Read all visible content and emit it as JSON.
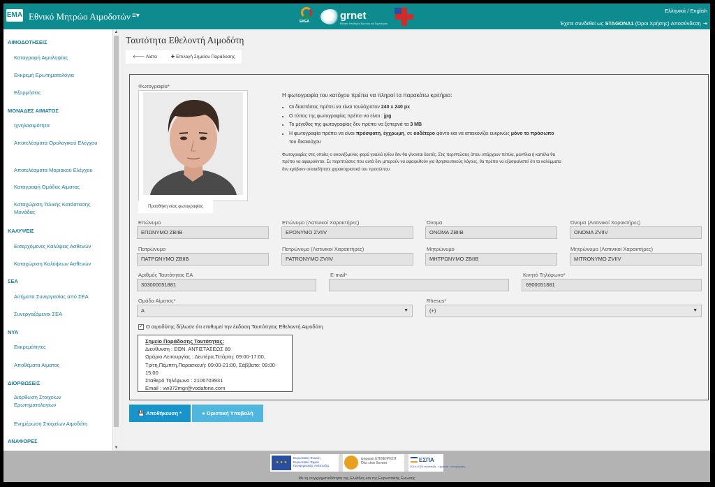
{
  "header": {
    "logo_text": "EMA",
    "app_title": "Εθνικό Μητρώο Αιμοδοτών",
    "menu_toggle": "≡▾",
    "edha_label": "ΕΚΕΑ",
    "grnet_label": "grnet",
    "grnet_tagline": "Εθνικές Υποδομές Έρευνας και Τεχνολογίας",
    "language": "Ελληνικά / English",
    "login_prefix": "Έχετε συνδεθεί ως ",
    "username": "STAGONA1",
    "terms": " (Όροι Χρήσης)",
    "logout": " Αποσύνδεση",
    "logout_icon": "⇥"
  },
  "sidebar": {
    "sections": [
      {
        "title": "ΑΙΜΟΔΟΤΗΣΕΙΣ",
        "items": [
          "Καταγραφή Αιμοληψίας",
          "Εκκρεμή Ερωτηματολόγια",
          "Εξορμήσεις"
        ]
      },
      {
        "title": "ΜΟΝΑΔΕΣ ΑΙΜΑΤΟΣ",
        "items": [
          "Ιχνηλασιμότητα",
          "Αποτελέσματα Ορολογικού Ελέγχου",
          "Αποτελέσματα Μοριακού Ελέγχου",
          "Καταγραφή Ομάδας Αίματος",
          "Καταχώριση Τελικής Κατάστασης Μονάδας"
        ]
      },
      {
        "title": "ΚΑΛΥΨΕΙΣ",
        "items": [
          "Εισερχόμενες Καλύψεις Ασθενών",
          "Καταχώριση Καλύψεων Ασθενών"
        ]
      },
      {
        "title": "ΣΕΑ",
        "items": [
          "Αιτήματα Συνεργασίας από ΣΕΑ",
          "Συνεργαζόμενοι ΣΕΑ"
        ]
      },
      {
        "title": "ΝΥΑ",
        "items": [
          "Εκκρεμότητες",
          "Αποθέματα Αίματος"
        ]
      },
      {
        "title": "ΔΙΟΡΘΩΣΕΙΣ",
        "items": [
          "Διόρθωση Στοιχείων Ερωτηματολογίων",
          "Ενημέρωση Στοιχείων Αιμοδότη"
        ]
      },
      {
        "title": "ΑΝΑΦΟΡΕΣ",
        "items": []
      }
    ]
  },
  "main": {
    "page_title": "Ταυτότητα Εθελοντή Αιμοδότη",
    "tabs": [
      "🡐 Λίστα",
      "✚ Επιλογή Σημείου Παράδοσης"
    ],
    "photo_label": "Φωτογραφία*",
    "add_photo": "Προσθήκη νέας φωτογραφίας",
    "criteria_title": "Η φωτογραφία του κατόχου πρέπει να πληροί τα παρακάτω κριτήρια:",
    "criteria": [
      {
        "pre": "Οι διαστάσεις πρέπει να είναι τουλάχιστον ",
        "bold": "240 x 240 px",
        "post": ""
      },
      {
        "pre": "Ο τύπος της φωτογραφίας πρέπει να είναι : ",
        "bold": "jpg",
        "post": ""
      },
      {
        "pre": "Το μέγεθος της φωτογραφίας δεν πρέπει να ξεπερνά τα ",
        "bold": "3 MB",
        "post": ""
      }
    ],
    "criteria_last": {
      "a": "Η φωτογραφία πρέπει να είναι ",
      "b": "πρόσφατη",
      "c": ", ",
      "d": "έγχρωμη",
      "e": ", σε ",
      "f": "ουδέτερο",
      "g": " φόντο και να απεικονίζει ευκρινώς ",
      "h": "μόνο το πρόσωπο",
      "i": " του δικαιούχου"
    },
    "criteria_note": "Φωτογραφίες στις οποίες ο εικονιζόμενος φορά γυαλιά ηλίου δεν θα γίνονται δεκτές. Στις περιπτώσεις όπου υπάρχουν πέπλα, μαντίλια ή καπέλα θα πρέπει να αφαιρούνται. Σε περιπτώσεις που αυτά δεν μπορούν να αφαιρεθούν για θρησκευτικούς λόγους, θα πρέπει να εξασφαλιστεί ότι τα καλύμματα δεν κρύβουν οποιαδήποτε χαρακτηριστικά του προσώπου.",
    "fields": {
      "surname": {
        "label": "Επώνυμο",
        "value": "ΕΠΩΝΥΜΟ ZBIIB"
      },
      "surname_latin": {
        "label": "Επώνυμο (Λατινικοί Χαρακτήρες)",
        "value": "EPONYMO ZVIIV"
      },
      "name": {
        "label": "Όνομα",
        "value": "ΟΝΟΜΑ ZBIIB"
      },
      "name_latin": {
        "label": "Όνομα (Λατινικοί Χαρακτήρες)",
        "value": "ONOMA ZVIIV"
      },
      "father": {
        "label": "Πατρώνυμο",
        "value": "ΠΑΤΡΩΝΥΜΟ ZBIIB"
      },
      "father_latin": {
        "label": "Πατρώνυμο (Λατινικοί Χαρακτήρες)",
        "value": "PATRONYMO ZVIIV"
      },
      "mother": {
        "label": "Μητρώνυμο",
        "value": "ΜΗΤΡΩΝΥΜΟ ZBIIB"
      },
      "mother_latin": {
        "label": "Μητρώνυμο (Λατινικοί Χαρακτήρες)",
        "value": "MITRONYMO ZVIIV"
      },
      "id_number": {
        "label": "Αριθμός Ταυτότητας ΕΑ",
        "value": "303000051881"
      },
      "email": {
        "label": "E-mail*",
        "value": ""
      },
      "mobile": {
        "label": "Κινητό Τηλέφωνο*",
        "value": "6900051881"
      },
      "blood_group": {
        "label": "Ομάδα Αίματος*",
        "value": "A"
      },
      "rhesus": {
        "label": "Rhesus*",
        "value": "(+)"
      }
    },
    "consent_check": "✓",
    "consent_label": "Ο αιμοδότης δήλωσε ότι επιθυμεί την έκδοση Ταυτότητας Εθελοντή Αιμοδότη",
    "delivery": {
      "title": "Σημείο Παράδοσης Ταυτότητας:",
      "address": "Διεύθυνση : ΕΘΝ. ΑΝΤΙΣΤΑΣΕΩΣ 89",
      "hours_1": "Ωράριο Λειτουργίας : Δευτέρα,Τετάρτη: 09:00-17:00, Τρίτη,Πέμπτη,Παρασκευή: 09:00-21:00, Σάββατο: 09:00-15:00",
      "phone": "Σταθερό Τηλέφωνο : 2106703931",
      "email": "Email : vw372mgr@vodafone.com"
    },
    "save_button": "💾 Αποθήκευση *",
    "submit_button": "● Οριστική Υποβολή"
  },
  "footer": {
    "eu_text": "Ευρωπαϊκή Ένωση Ευρωπαϊκό Ταμείο Περιφερειακής Ανάπτυξης",
    "ops_text": "ψηφιακή ΕΠΙΧΕΙΡΗΣΗ Όλο είναι δυνατό",
    "espa_text": "ΕΣΠΑ",
    "espa_sub": "2014-2020 ανάπτυξη - εργασία - αλληλεγγύη",
    "note": "Με τη συγχρηματοδότηση της Ελλάδας και της Ευρωπαϊκής Ένωσης"
  },
  "colors": {
    "header": "#0d8b8f",
    "link": "#1a7a9c",
    "save": "#1794c9",
    "submit": "#4fb6dd"
  }
}
